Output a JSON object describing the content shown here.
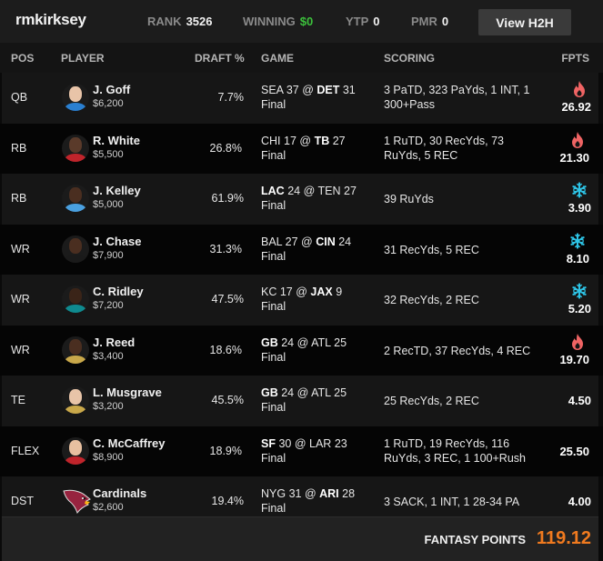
{
  "header": {
    "username": "rmkirksey",
    "rank_label": "RANK",
    "rank_value": "3526",
    "winning_label": "WINNING",
    "winning_value": "$0",
    "ytp_label": "YTP",
    "ytp_value": "0",
    "pmr_label": "PMR",
    "pmr_value": "0",
    "h2h_button": "View H2H"
  },
  "columns": {
    "pos": "POS",
    "player": "PLAYER",
    "draft": "DRAFT %",
    "game": "GAME",
    "scoring": "SCORING",
    "fpts": "FPTS"
  },
  "colors": {
    "hot": "#f06464",
    "cold": "#2ec4e6",
    "winning": "#3cc13c",
    "total": "#f07a1f"
  },
  "rows": [
    {
      "pos": "QB",
      "name": "J. Goff",
      "salary": "$6,200",
      "draft": "7.7%",
      "away": "SEA",
      "away_score": "37",
      "home": "DET",
      "home_score": "31",
      "bold_team": "home",
      "status": "Final",
      "scoring": "3 PaTD, 323 PaYds, 1 INT, 1 300+Pass",
      "fpts": "26.92",
      "icon": "fire-icon",
      "jersey": "#2a7fd0",
      "skin": "#e8c4a8"
    },
    {
      "pos": "RB",
      "name": "R. White",
      "salary": "$5,500",
      "draft": "26.8%",
      "away": "CHI",
      "away_score": "17",
      "home": "TB",
      "home_score": "27",
      "bold_team": "home",
      "status": "Final",
      "scoring": "1 RuTD, 30 RecYds, 73 RuYds, 5 REC",
      "fpts": "21.30",
      "icon": "fire-icon",
      "jersey": "#c0242b",
      "skin": "#5a3a2a"
    },
    {
      "pos": "RB",
      "name": "J. Kelley",
      "salary": "$5,000",
      "draft": "61.9%",
      "away": "LAC",
      "away_score": "24",
      "home": "TEN",
      "home_score": "27",
      "bold_team": "away",
      "status": "Final",
      "scoring": "39 RuYds",
      "fpts": "3.90",
      "icon": "snowflake-icon",
      "jersey": "#4aa0e0",
      "skin": "#4a2e20"
    },
    {
      "pos": "WR",
      "name": "J. Chase",
      "salary": "$7,900",
      "draft": "31.3%",
      "away": "BAL",
      "away_score": "27",
      "home": "CIN",
      "home_score": "24",
      "bold_team": "home",
      "status": "Final",
      "scoring": "31 RecYds, 5 REC",
      "fpts": "8.10",
      "icon": "snowflake-icon",
      "jersey": "#1a1a1a",
      "skin": "#4a2e20"
    },
    {
      "pos": "WR",
      "name": "C. Ridley",
      "salary": "$7,200",
      "draft": "47.5%",
      "away": "KC",
      "away_score": "17",
      "home": "JAX",
      "home_score": "9",
      "bold_team": "home",
      "status": "Final",
      "scoring": "32 RecYds, 2 REC",
      "fpts": "5.20",
      "icon": "snowflake-icon",
      "jersey": "#0f8a8f",
      "skin": "#3a2418"
    },
    {
      "pos": "WR",
      "name": "J. Reed",
      "salary": "$3,400",
      "draft": "18.6%",
      "away": "GB",
      "away_score": "24",
      "home": "ATL",
      "home_score": "25",
      "bold_team": "away",
      "status": "Final",
      "scoring": "2 RecTD, 37 RecYds, 4 REC",
      "fpts": "19.70",
      "icon": "fire-icon",
      "jersey": "#c9a84a",
      "skin": "#4a2e20"
    },
    {
      "pos": "TE",
      "name": "L. Musgrave",
      "salary": "$3,200",
      "draft": "45.5%",
      "away": "GB",
      "away_score": "24",
      "home": "ATL",
      "home_score": "25",
      "bold_team": "away",
      "status": "Final",
      "scoring": "25 RecYds, 2 REC",
      "fpts": "4.50",
      "icon": "",
      "jersey": "#c9a84a",
      "skin": "#e8c4a8"
    },
    {
      "pos": "FLEX",
      "name": "C. McCaffrey",
      "salary": "$8,900",
      "draft": "18.9%",
      "away": "SF",
      "away_score": "30",
      "home": "LAR",
      "home_score": "23",
      "bold_team": "away",
      "status": "Final",
      "scoring": "1 RuTD, 19 RecYds, 116 RuYds, 3 REC, 1 100+Rush",
      "fpts": "25.50",
      "icon": "",
      "jersey": "#c0242b",
      "skin": "#e8c0a0"
    },
    {
      "pos": "DST",
      "name": "Cardinals",
      "salary": "$2,600",
      "draft": "19.4%",
      "away": "NYG",
      "away_score": "31",
      "home": "ARI",
      "home_score": "28",
      "bold_team": "home",
      "status": "Final",
      "scoring": "3 SACK, 1 INT, 1 28-34 PA",
      "fpts": "4.00",
      "icon": "",
      "logo": "cardinals-logo"
    }
  ],
  "footer": {
    "label": "FANTASY POINTS",
    "total": "119.12"
  }
}
